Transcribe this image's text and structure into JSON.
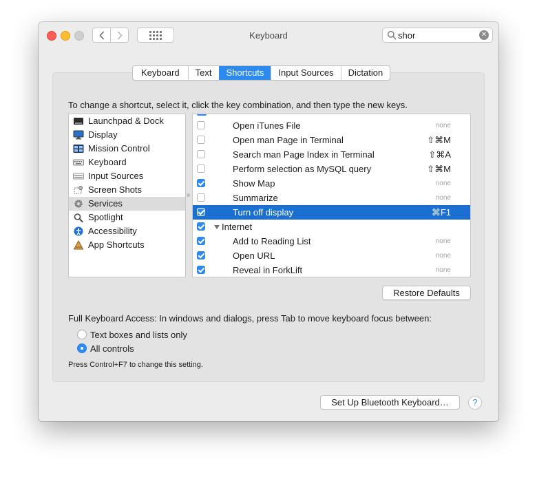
{
  "window": {
    "title": "Keyboard",
    "search": {
      "value": "shor",
      "placeholder": "Search"
    }
  },
  "tabs": [
    {
      "label": "Keyboard",
      "active": false
    },
    {
      "label": "Text",
      "active": false
    },
    {
      "label": "Shortcuts",
      "active": true
    },
    {
      "label": "Input Sources",
      "active": false
    },
    {
      "label": "Dictation",
      "active": false
    }
  ],
  "instructions": "To change a shortcut, select it, click the key combination, and then type the new keys.",
  "categories": [
    {
      "label": "Launchpad & Dock",
      "icon": "launchpad-icon"
    },
    {
      "label": "Display",
      "icon": "display-icon"
    },
    {
      "label": "Mission Control",
      "icon": "mission-control-icon"
    },
    {
      "label": "Keyboard",
      "icon": "keyboard-icon"
    },
    {
      "label": "Input Sources",
      "icon": "input-sources-icon"
    },
    {
      "label": "Screen Shots",
      "icon": "screenshot-icon"
    },
    {
      "label": "Services",
      "icon": "gear-icon",
      "selected": true
    },
    {
      "label": "Spotlight",
      "icon": "spotlight-icon"
    },
    {
      "label": "Accessibility",
      "icon": "accessibility-icon"
    },
    {
      "label": "App Shortcuts",
      "icon": "app-shortcuts-icon"
    }
  ],
  "shortcuts": [
    {
      "label": "Open iTunes File",
      "key": "none",
      "checked": false
    },
    {
      "label": "Open man Page in Terminal",
      "key": "⇧⌘M",
      "checked": false
    },
    {
      "label": "Search man Page Index in Terminal",
      "key": "⇧⌘A",
      "checked": false
    },
    {
      "label": "Perform selection as MySQL query",
      "key": "⇧⌘M",
      "checked": false
    },
    {
      "label": "Show Map",
      "key": "none",
      "checked": true
    },
    {
      "label": "Summarize",
      "key": "none",
      "checked": false
    },
    {
      "label": "Turn off display",
      "key": "⌘F1",
      "checked": true,
      "selected": true
    },
    {
      "label": "Internet",
      "key": "",
      "checked": true,
      "group": true
    },
    {
      "label": "Add to Reading List",
      "key": "none",
      "checked": true
    },
    {
      "label": "Open URL",
      "key": "none",
      "checked": true
    },
    {
      "label": "Reveal in ForkLift",
      "key": "none",
      "checked": true
    }
  ],
  "restore_defaults": "Restore Defaults",
  "full_keyboard_access": {
    "label": "Full Keyboard Access: In windows and dialogs, press Tab to move keyboard focus between:",
    "options": [
      {
        "label": "Text boxes and lists only",
        "checked": false
      },
      {
        "label": "All controls",
        "checked": true
      }
    ],
    "note": "Press Control+F7 to change this setting."
  },
  "bluetooth_button": "Set Up Bluetooth Keyboard…",
  "help": "?",
  "colors": {
    "accent": "#2d8bf0",
    "selection": "#1b6fd1"
  }
}
